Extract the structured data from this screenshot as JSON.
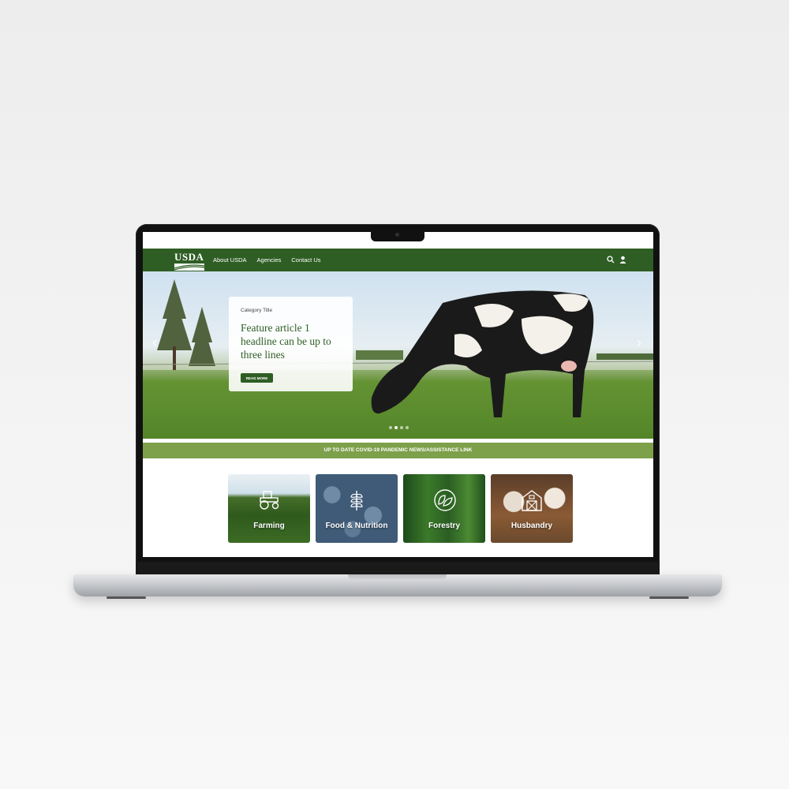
{
  "site": {
    "logo_text": "USDA",
    "nav": [
      "About USDA",
      "Agencies",
      "Contact Us"
    ]
  },
  "hero": {
    "category": "Category Title",
    "headline": "Feature article 1 headline can be up to three lines",
    "cta": "READ MORE",
    "slides": 4,
    "active_slide": 2
  },
  "banner": {
    "text": "UP TO DATE COVID-19 PANDEMIC NEWS/ASSISTANCE LINK"
  },
  "tiles": [
    {
      "label": "Farming",
      "icon": "tractor-icon"
    },
    {
      "label": "Food & Nutrition",
      "icon": "wheat-icon"
    },
    {
      "label": "Forestry",
      "icon": "leaves-icon"
    },
    {
      "label": "Husbandry",
      "icon": "barn-icon"
    }
  ],
  "colors": {
    "header_green": "#2e5e24",
    "banner_green": "#7da04a",
    "laptop_body": "#111111"
  }
}
